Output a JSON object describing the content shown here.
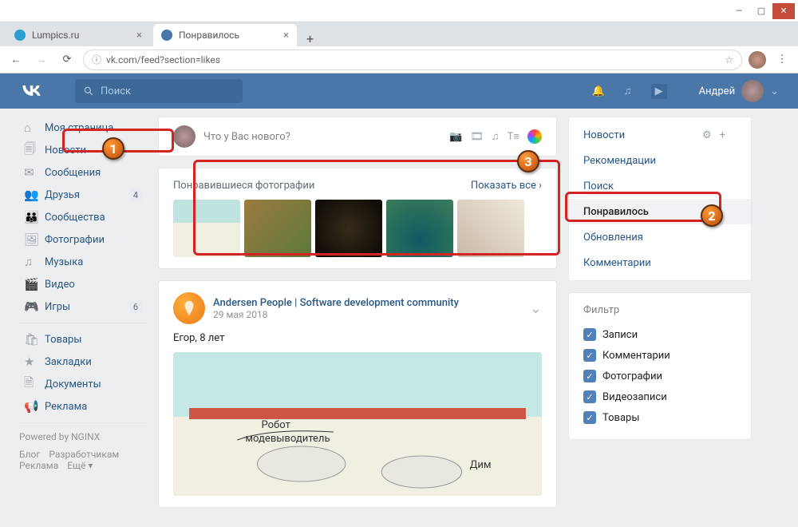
{
  "browser": {
    "tabs": [
      {
        "title": "Lumpics.ru",
        "active": false,
        "favicon": "#2c9ed2"
      },
      {
        "title": "Понравилось",
        "active": true,
        "favicon": "#4a76a8"
      }
    ],
    "url": "vk.com/feed?section=likes"
  },
  "header": {
    "search_placeholder": "Поиск",
    "user_name": "Андрей"
  },
  "sidebar": {
    "items": [
      {
        "label": "Моя страница",
        "icon": "home",
        "badge": null
      },
      {
        "label": "Новости",
        "icon": "news",
        "badge": null
      },
      {
        "label": "Сообщения",
        "icon": "messages",
        "badge": null
      },
      {
        "label": "Друзья",
        "icon": "friends",
        "badge": "4"
      },
      {
        "label": "Сообщества",
        "icon": "groups",
        "badge": null
      },
      {
        "label": "Фотографии",
        "icon": "photos",
        "badge": null
      },
      {
        "label": "Музыка",
        "icon": "music",
        "badge": null
      },
      {
        "label": "Видео",
        "icon": "video",
        "badge": null
      },
      {
        "label": "Игры",
        "icon": "games",
        "badge": "6"
      }
    ],
    "extra": [
      {
        "label": "Товары",
        "icon": "market"
      },
      {
        "label": "Закладки",
        "icon": "bookmarks"
      },
      {
        "label": "Документы",
        "icon": "docs"
      },
      {
        "label": "Реклама",
        "icon": "ads"
      }
    ],
    "powered": "Powered by NGINX",
    "footer": [
      "Блог",
      "Разработчикам",
      "Реклама",
      "Ещё ▾"
    ]
  },
  "composer": {
    "placeholder": "Что у Вас нового?"
  },
  "liked_photos": {
    "title": "Понравившиеся фотографии",
    "show_all": "Показать все"
  },
  "post": {
    "author": "Andersen People | Software development community",
    "date": "29 мая 2018",
    "text": "Егор, 8 лет"
  },
  "right_nav": {
    "items": [
      "Новости",
      "Рекомендации",
      "Поиск",
      "Понравилось",
      "Обновления",
      "Комментарии"
    ],
    "active_index": 3
  },
  "filter": {
    "title": "Фильтр",
    "items": [
      "Записи",
      "Комментарии",
      "Фотографии",
      "Видеозаписи",
      "Товары"
    ]
  },
  "markers": {
    "m1": "1",
    "m2": "2",
    "m3": "3"
  }
}
